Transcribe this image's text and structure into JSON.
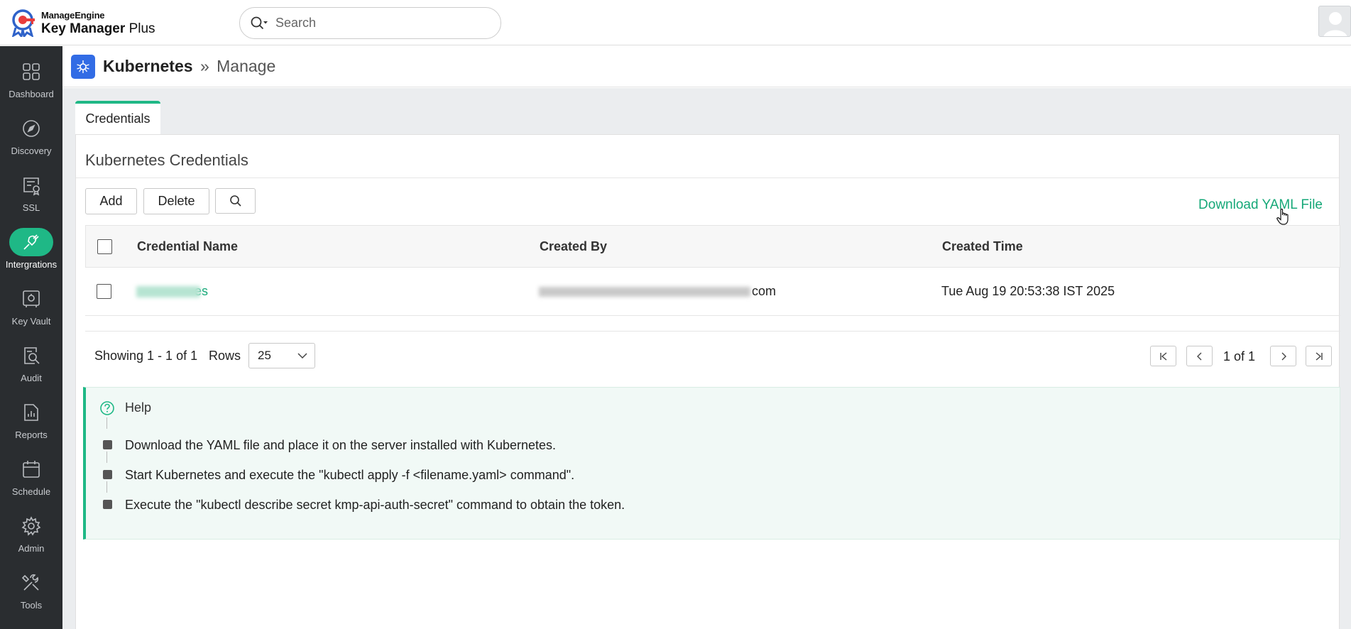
{
  "app": {
    "brand": "ManageEngine",
    "product_main": "Key Manager",
    "product_suffix": "Plus"
  },
  "search": {
    "placeholder": "Search"
  },
  "sidebar": {
    "items": [
      {
        "label": "Dashboard",
        "icon": "dashboard-icon"
      },
      {
        "label": "Discovery",
        "icon": "compass-icon"
      },
      {
        "label": "SSL",
        "icon": "certificate-icon"
      },
      {
        "label": "Intergrations",
        "icon": "plug-icon",
        "active": true
      },
      {
        "label": "Key Vault",
        "icon": "vault-icon"
      },
      {
        "label": "Audit",
        "icon": "audit-search-icon"
      },
      {
        "label": "Reports",
        "icon": "reports-icon"
      },
      {
        "label": "Schedule",
        "icon": "calendar-icon"
      },
      {
        "label": "Admin",
        "icon": "gear-icon"
      },
      {
        "label": "Tools",
        "icon": "tools-icon"
      }
    ]
  },
  "header": {
    "title": "Kubernetes",
    "separator": "»",
    "subtitle": "Manage"
  },
  "tabs": [
    {
      "label": "Credentials",
      "active": true
    }
  ],
  "panel": {
    "title": "Kubernetes Credentials",
    "buttons": {
      "add": "Add",
      "delete": "Delete"
    },
    "download_link": "Download YAML File"
  },
  "table": {
    "columns": [
      "Credential Name",
      "Created By",
      "Created Time"
    ],
    "rows": [
      {
        "credential_name_visible": "es",
        "created_by_visible": "com",
        "created_time": "Tue Aug 19 20:53:38 IST 2025"
      }
    ]
  },
  "pagination": {
    "showing": "Showing 1 - 1 of 1",
    "rows_label": "Rows",
    "rows_value": "25",
    "page_info": "1 of 1"
  },
  "help": {
    "title": "Help",
    "steps": [
      "Download the YAML file and place it on the server installed with Kubernetes.",
      "Start Kubernetes and execute the \"kubectl apply -f <filename.yaml> command\".",
      "Execute the \"kubectl describe secret kmp-api-auth-secret\" command to obtain the token."
    ]
  },
  "colors": {
    "accent": "#1fb886",
    "link": "#16a878",
    "sidebar_bg": "#2a2d30",
    "kubernetes_blue": "#326ce5"
  }
}
